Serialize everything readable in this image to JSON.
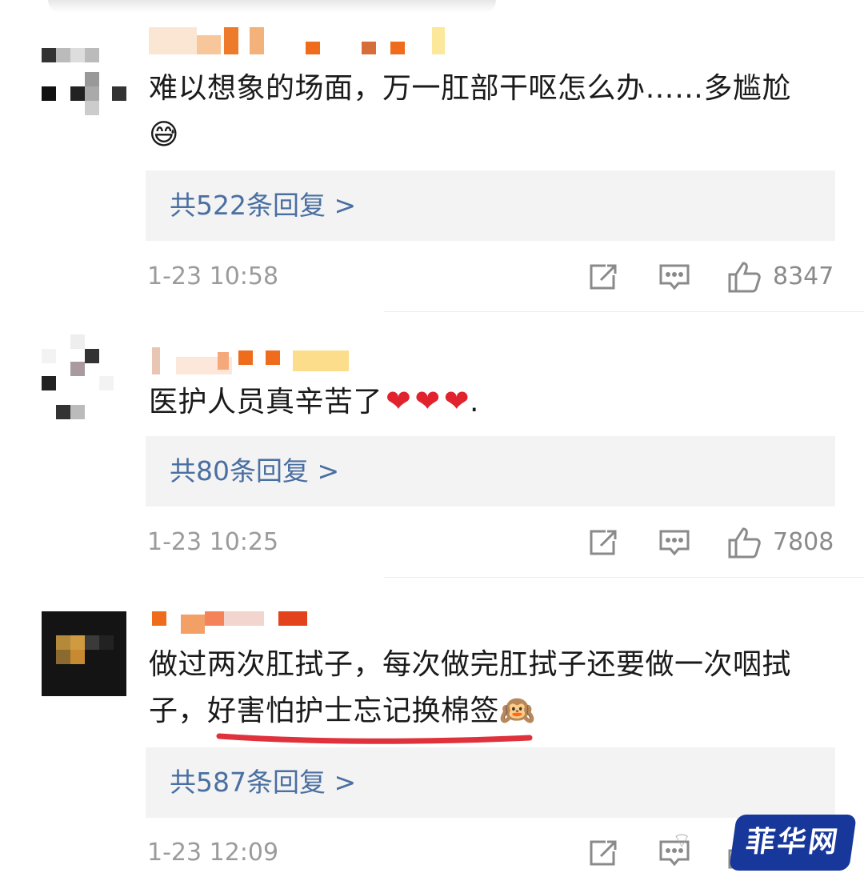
{
  "comments": [
    {
      "text": "难以想象的场面，万一肛部干呕怎么办……多尴尬",
      "emoji": "😅",
      "replies": "共522条回复 >",
      "time": "1-23 10:58",
      "likes": "8347"
    },
    {
      "text": "医护人员真辛苦了",
      "hearts": [
        "❤",
        "❤",
        "❤"
      ],
      "tail": ".",
      "replies": "共80条回复 >",
      "time": "1-23 10:25",
      "likes": "7808"
    },
    {
      "text_line1": "做过两次肛拭子，每次做完肛拭子还要做一次咽拭",
      "text_line2": "子，好害怕护士忘记换棉签",
      "emoji": "🙉",
      "replies": "共587条回复 >",
      "time": "1-23 12:09",
      "likes": ""
    }
  ],
  "icons": {
    "share": "share-icon",
    "comment": "comment-icon",
    "like": "thumbs-up-icon"
  },
  "watermark": {
    "icon": "wechat-icon",
    "text": "菲华网"
  },
  "colors": {
    "reply_link": "#4a6fa1",
    "meta_gray": "#9b9b9b",
    "reply_bg": "#f3f3f3",
    "underline": "#e0323c",
    "watermark_bg": "#17379a"
  }
}
